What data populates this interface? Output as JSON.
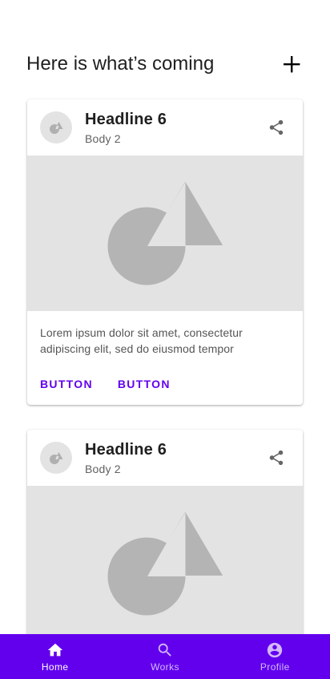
{
  "header": {
    "title": "Here is what’s coming",
    "add_icon": "plus-icon"
  },
  "cards": [
    {
      "headline": "Headline 6",
      "subhead": "Body 2",
      "avatar_icon": "placeholder-shapes-icon",
      "share_icon": "share-icon",
      "media_icon": "placeholder-shapes-image",
      "body": "Lorem ipsum dolor sit amet, consectetur adipiscing elit, sed do eiusmod tempor",
      "actions": [
        "BUTTON",
        "BUTTON"
      ]
    },
    {
      "headline": "Headline 6",
      "subhead": "Body 2",
      "avatar_icon": "placeholder-shapes-icon",
      "share_icon": "share-icon",
      "media_icon": "placeholder-shapes-image"
    }
  ],
  "bottom_nav": {
    "items": [
      {
        "label": "Home",
        "icon": "home-icon",
        "active": true
      },
      {
        "label": "Works",
        "icon": "search-icon",
        "active": false
      },
      {
        "label": "Profile",
        "icon": "account-circle-icon",
        "active": false
      }
    ]
  },
  "colors": {
    "primary": "#6200ee",
    "placeholder_bg": "#e3e3e3",
    "placeholder_shape": "#b4b4b4"
  }
}
